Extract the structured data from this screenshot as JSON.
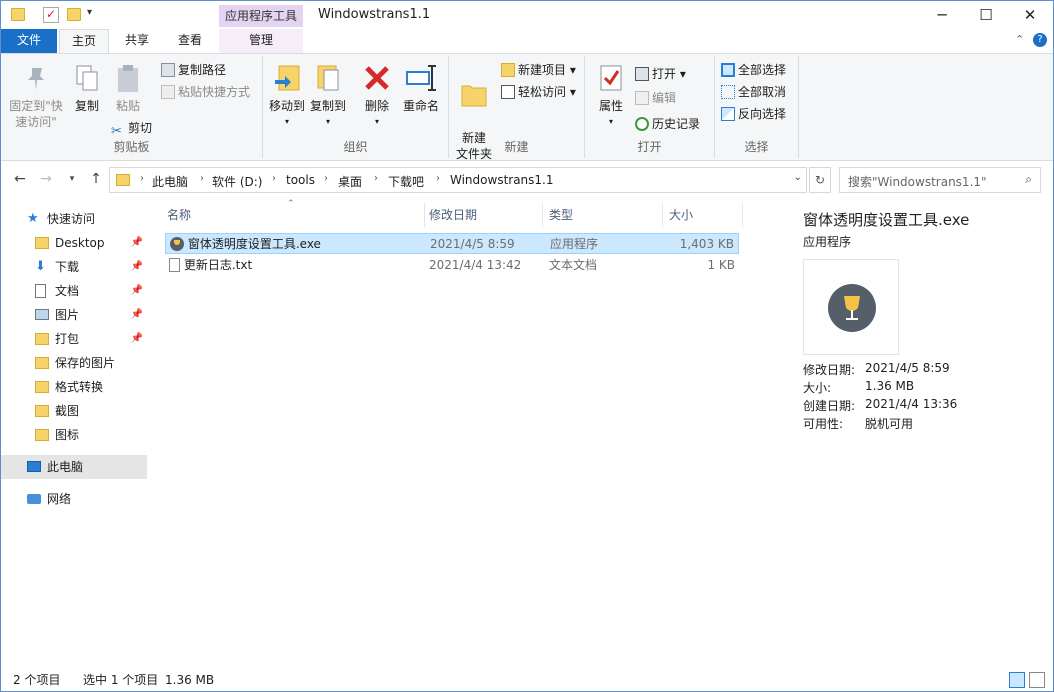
{
  "window": {
    "title": "Windowstrans1.1",
    "context_tab": "应用程序工具"
  },
  "tabs": {
    "file": "文件",
    "home": "主页",
    "share": "共享",
    "view": "查看",
    "manage": "管理"
  },
  "ribbon": {
    "clipboard": {
      "pin": "固定到\"快速访问\"",
      "copy": "复制",
      "paste": "粘贴",
      "copy_path": "复制路径",
      "paste_shortcut": "粘贴快捷方式",
      "cut": "剪切",
      "label": "剪贴板"
    },
    "organize": {
      "move_to": "移动到",
      "copy_to": "复制到",
      "delete": "删除",
      "rename": "重命名",
      "label": "组织"
    },
    "new": {
      "new_folder": "新建\n文件夹",
      "new_item": "新建项目",
      "easy_access": "轻松访问",
      "label": "新建"
    },
    "open": {
      "properties": "属性",
      "open": "打开",
      "edit": "编辑",
      "history": "历史记录",
      "label": "打开"
    },
    "select": {
      "select_all": "全部选择",
      "select_none": "全部取消",
      "invert": "反向选择",
      "label": "选择"
    }
  },
  "address": {
    "crumbs": [
      "此电脑",
      "软件 (D:)",
      "tools",
      "桌面",
      "下载吧",
      "Windowstrans1.1"
    ],
    "search_placeholder": "搜索\"Windowstrans1.1\""
  },
  "nav": {
    "quick_access": "快速访问",
    "items": [
      {
        "label": "Desktop",
        "pinned": true
      },
      {
        "label": "下载",
        "pinned": true
      },
      {
        "label": "文档",
        "pinned": true
      },
      {
        "label": "图片",
        "pinned": true
      },
      {
        "label": "打包",
        "pinned": true
      },
      {
        "label": "保存的图片",
        "pinned": false
      },
      {
        "label": "格式转换",
        "pinned": false
      },
      {
        "label": "截图",
        "pinned": false
      },
      {
        "label": "图标",
        "pinned": false
      }
    ],
    "this_pc": "此电脑",
    "network": "网络"
  },
  "columns": {
    "name": "名称",
    "modified": "修改日期",
    "type": "类型",
    "size": "大小"
  },
  "files": [
    {
      "name": "窗体透明度设置工具.exe",
      "modified": "2021/4/5 8:59",
      "type": "应用程序",
      "size": "1,403 KB",
      "selected": true
    },
    {
      "name": "更新日志.txt",
      "modified": "2021/4/4 13:42",
      "type": "文本文档",
      "size": "1 KB",
      "selected": false
    }
  ],
  "preview": {
    "name": "窗体透明度设置工具.exe",
    "type": "应用程序",
    "props": [
      {
        "k": "修改日期:",
        "v": "2021/4/5 8:59"
      },
      {
        "k": "大小:",
        "v": "1.36 MB"
      },
      {
        "k": "创建日期:",
        "v": "2021/4/4 13:36"
      },
      {
        "k": "可用性:",
        "v": "脱机可用"
      }
    ]
  },
  "status": {
    "count": "2 个项目",
    "selected": "选中 1 个项目",
    "size": "1.36 MB"
  },
  "colors": {
    "accent": "#1a6fc6",
    "selection": "#cce8ff",
    "context_tab": "#e5d3f2"
  }
}
